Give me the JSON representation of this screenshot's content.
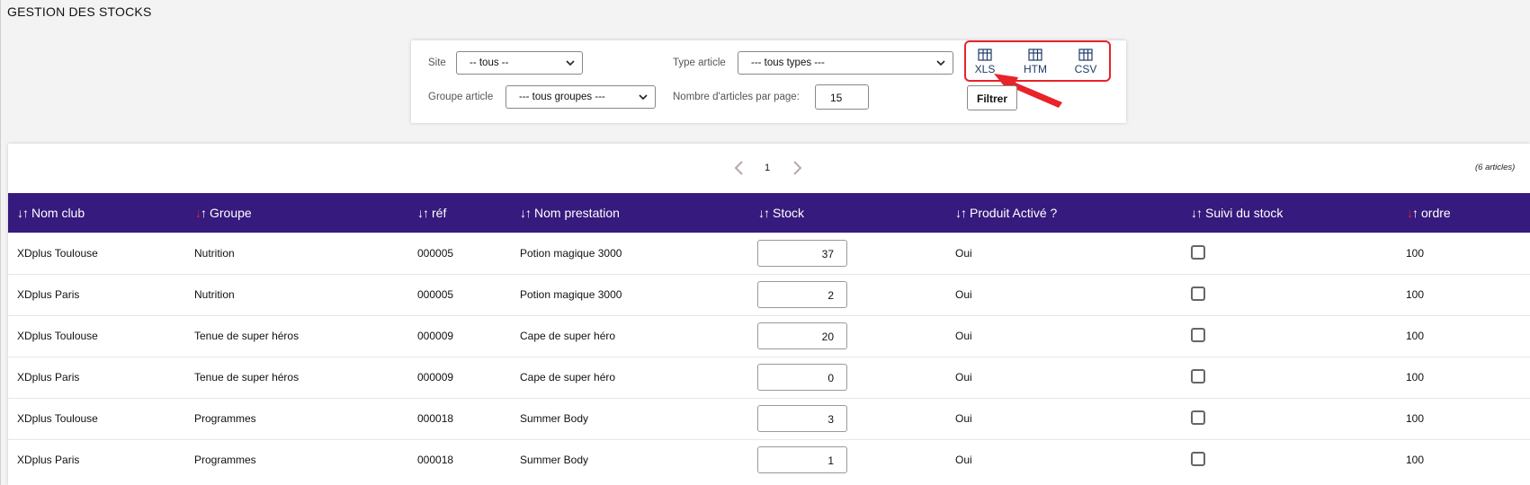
{
  "page": {
    "title": "GESTION DES STOCKS"
  },
  "filters": {
    "site_label": "Site",
    "site_value": "-- tous --",
    "type_label": "Type article",
    "type_value": "--- tous types ---",
    "groupe_label": "Groupe article",
    "groupe_value": "--- tous groupes ---",
    "per_page_label": "Nombre d'articles par page:",
    "per_page_value": "15",
    "filter_button": "Filtrer"
  },
  "exports": [
    {
      "label": "XLS",
      "icon": "table-icon"
    },
    {
      "label": "HTM",
      "icon": "table-icon"
    },
    {
      "label": "CSV",
      "icon": "table-icon"
    }
  ],
  "pagination": {
    "current": "1",
    "count_text": "(6 articles)"
  },
  "columns": [
    {
      "label": "Nom club",
      "sorted": false
    },
    {
      "label": "Groupe",
      "sorted": true
    },
    {
      "label": "réf",
      "sorted": false
    },
    {
      "label": "Nom prestation",
      "sorted": false
    },
    {
      "label": "Stock",
      "sorted": false
    },
    {
      "label": "Produit Activé ?",
      "sorted": false
    },
    {
      "label": "Suivi du stock",
      "sorted": false
    },
    {
      "label": "ordre",
      "sorted": true
    }
  ],
  "rows": [
    {
      "club": "XDplus Toulouse",
      "groupe": "Nutrition",
      "ref": "000005",
      "prestation": "Potion magique 3000",
      "stock": "37",
      "active": "Oui",
      "ordre": "100"
    },
    {
      "club": "XDplus Paris",
      "groupe": "Nutrition",
      "ref": "000005",
      "prestation": "Potion magique 3000",
      "stock": "2",
      "active": "Oui",
      "ordre": "100"
    },
    {
      "club": "XDplus Toulouse",
      "groupe": "Tenue de super héros",
      "ref": "000009",
      "prestation": "Cape de super héro",
      "stock": "20",
      "active": "Oui",
      "ordre": "100"
    },
    {
      "club": "XDplus Paris",
      "groupe": "Tenue de super héros",
      "ref": "000009",
      "prestation": "Cape de super héro",
      "stock": "0",
      "active": "Oui",
      "ordre": "100"
    },
    {
      "club": "XDplus Toulouse",
      "groupe": "Programmes",
      "ref": "000018",
      "prestation": "Summer Body",
      "stock": "3",
      "active": "Oui",
      "ordre": "100"
    },
    {
      "club": "XDplus Paris",
      "groupe": "Programmes",
      "ref": "000018",
      "prestation": "Summer Body",
      "stock": "1",
      "active": "Oui",
      "ordre": "100"
    }
  ],
  "colors": {
    "header_bg": "#361a7d",
    "highlight": "#e8232a"
  }
}
